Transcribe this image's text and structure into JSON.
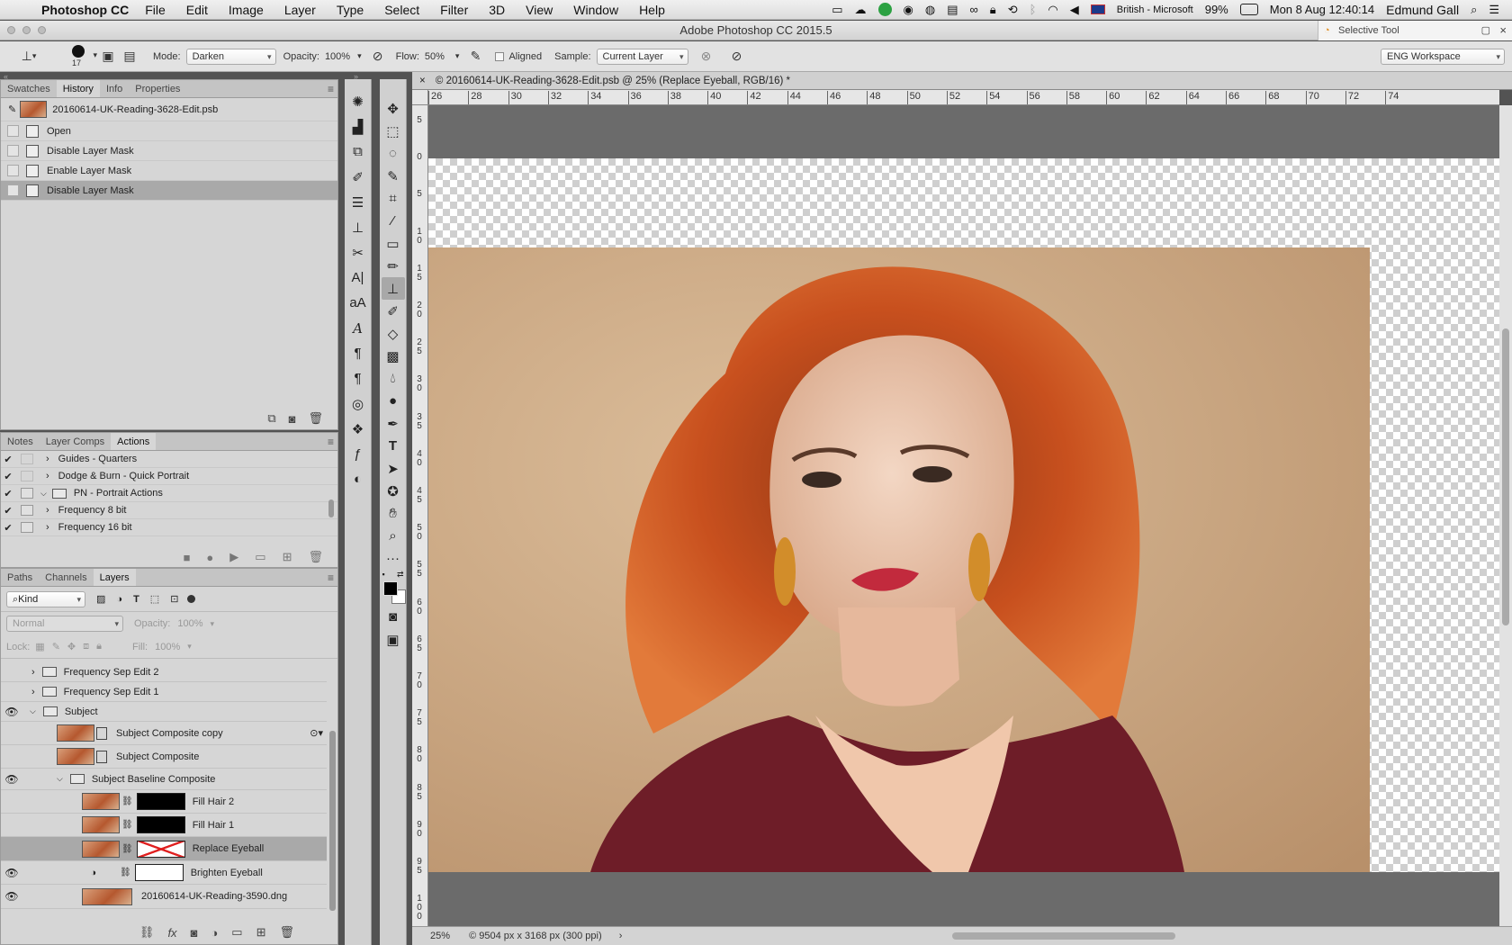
{
  "menubar": {
    "app_name": "Photoshop CC",
    "items": [
      "File",
      "Edit",
      "Image",
      "Layer",
      "Type",
      "Select",
      "Filter",
      "3D",
      "View",
      "Window",
      "Help"
    ],
    "input_source": "British - Microsoft",
    "battery": "99%",
    "clock": "Mon 8 Aug  12:40:14",
    "user": "Edmund Gall"
  },
  "window": {
    "title": "Adobe Photoshop CC 2015.5",
    "selective_tool": "Selective Tool"
  },
  "options": {
    "brush_size": "17",
    "mode_label": "Mode:",
    "mode_value": "Darken",
    "opacity_label": "Opacity:",
    "opacity_value": "100%",
    "flow_label": "Flow:",
    "flow_value": "50%",
    "aligned_label": "Aligned",
    "sample_label": "Sample:",
    "sample_value": "Current Layer",
    "workspace": "ENG Workspace"
  },
  "history_panel": {
    "tabs": [
      "Swatches",
      "History",
      "Info",
      "Properties"
    ],
    "active_tab": "History",
    "snapshot": "20160614-UK-Reading-3628-Edit.psb",
    "states": [
      "Open",
      "Disable Layer Mask",
      "Enable Layer Mask",
      "Disable Layer Mask"
    ]
  },
  "actions_panel": {
    "tabs": [
      "Notes",
      "Layer Comps",
      "Actions"
    ],
    "active_tab": "Actions",
    "items": [
      {
        "label": "Guides - Quarters",
        "indent": 1
      },
      {
        "label": "Dodge & Burn - Quick Portrait",
        "indent": 1
      },
      {
        "label": "PN - Portrait Actions",
        "indent": 0
      },
      {
        "label": "Frequency 8 bit",
        "indent": 1
      },
      {
        "label": "Frequency 16 bit",
        "indent": 1
      }
    ]
  },
  "layers_panel": {
    "tabs": [
      "Paths",
      "Channels",
      "Layers"
    ],
    "active_tab": "Layers",
    "filter_kind": "Kind",
    "blend_mode": "Normal",
    "opacity_label": "Opacity:",
    "opacity_value": "100%",
    "lock_label": "Lock:",
    "fill_label": "Fill:",
    "fill_value": "100%",
    "layers": [
      {
        "name": "Frequency Sep Edit 2",
        "type": "group"
      },
      {
        "name": "Frequency Sep Edit 1",
        "type": "group"
      },
      {
        "name": "Subject",
        "type": "group"
      },
      {
        "name": "Subject Composite copy",
        "type": "smart"
      },
      {
        "name": "Subject Composite",
        "type": "smart"
      },
      {
        "name": "Subject Baseline Composite",
        "type": "group"
      },
      {
        "name": "Fill Hair 2",
        "type": "masked"
      },
      {
        "name": "Fill Hair 1",
        "type": "masked"
      },
      {
        "name": "Replace Eyeball",
        "type": "masked"
      },
      {
        "name": "Brighten Eyeball",
        "type": "adjustment"
      },
      {
        "name": "20160614-UK-Reading-3590.dng",
        "type": "pixel"
      }
    ]
  },
  "document": {
    "tab_title": "© 20160614-UK-Reading-3628-Edit.psb @ 25% (Replace Eyeball, RGB/16) *",
    "ruler_h": [
      "26",
      "28",
      "30",
      "32",
      "34",
      "36",
      "38",
      "40",
      "42",
      "44",
      "46",
      "48",
      "50",
      "52",
      "54",
      "56",
      "58",
      "60",
      "62",
      "64",
      "66",
      "68",
      "70",
      "72",
      "74"
    ],
    "ruler_v": [
      "5",
      "0",
      "5",
      "1 0",
      "1 5",
      "2 0",
      "2 5",
      "3 0",
      "3 5",
      "4 0",
      "4 5",
      "5 0",
      "5 5",
      "6 0",
      "6 5",
      "7 0",
      "7 5",
      "8 0",
      "8 5",
      "9 0",
      "9 5",
      "1 0 0"
    ],
    "zoom": "25%",
    "doc_info": "© 9504 px x 3168 px (300 ppi)"
  },
  "colors": {
    "background_tan": "#c9a582",
    "hair": "#c8501e",
    "top_dress": "#6e1d28",
    "lips": "#c22a3d"
  }
}
